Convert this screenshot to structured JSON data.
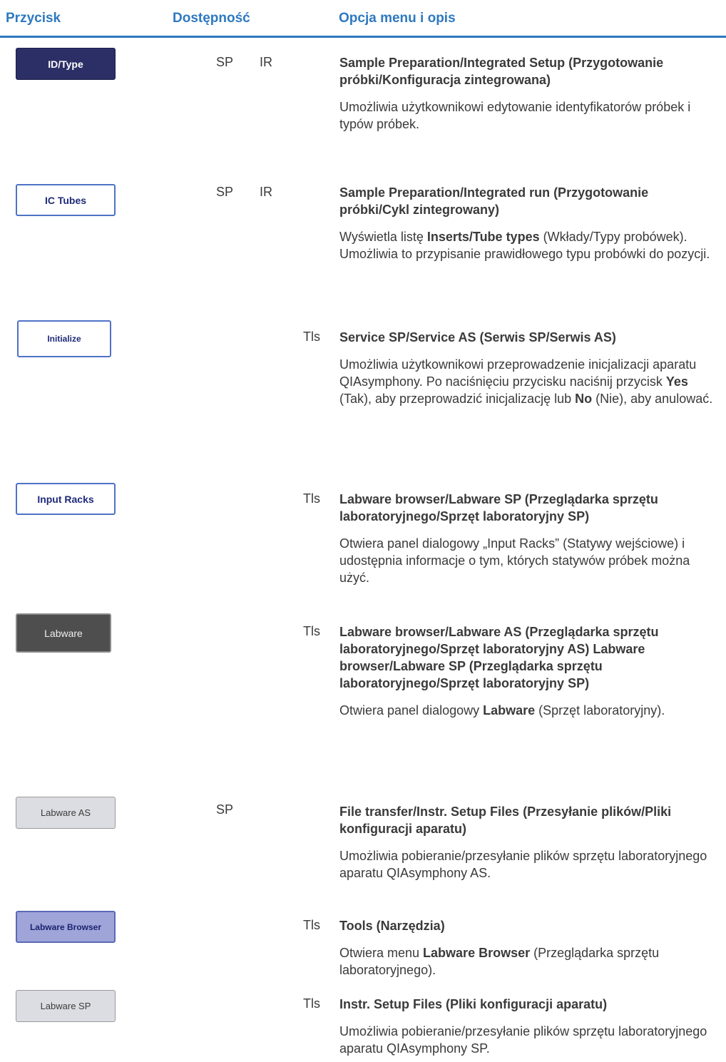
{
  "header": {
    "col1": "Przycisk",
    "col2": "Dostępność",
    "col3": "Opcja menu i opis"
  },
  "rows": [
    {
      "button": "ID/Type",
      "avail": [
        "SP",
        "IR"
      ],
      "title": "Sample Preparation/Integrated Setup (Przygotowanie próbki/Konfiguracja zintegrowana)",
      "desc": "Umożliwia użytkownikowi edytowanie identyfikatorów próbek i typów próbek."
    },
    {
      "button": "IC Tubes",
      "avail": [
        "SP",
        "IR"
      ],
      "title": "Sample Preparation/Integrated run (Przygotowanie próbki/Cykl zintegrowany)",
      "desc_a": "Wyświetla listę ",
      "desc_b": "Inserts/Tube types",
      "desc_c": " (Wkłady/Typy probówek). Umożliwia to przypisanie prawidłowego typu probówki do pozycji."
    },
    {
      "button": "Initialize",
      "avail": [
        "Tls"
      ],
      "title": "Service SP/Service AS (Serwis SP/Serwis AS)",
      "desc_a": "Umożliwia użytkownikowi przeprowadzenie inicjalizacji aparatu QIAsymphony. Po naciśnięciu przycisku naciśnij przycisk ",
      "desc_b": "Yes",
      "desc_c": " (Tak), aby przeprowadzić inicjalizację lub ",
      "desc_d": "No",
      "desc_e": " (Nie), aby anulować."
    },
    {
      "button": "Input Racks",
      "avail": [
        "Tls"
      ],
      "title": "Labware browser/Labware SP (Przeglądarka sprzętu laboratoryjnego/Sprzęt laboratoryjny SP)",
      "desc": "Otwiera panel dialogowy „Input Racks” (Statywy wejściowe) i udostępnia informacje o tym, których statywów próbek można użyć."
    },
    {
      "button": "Labware",
      "avail": [
        "Tls"
      ],
      "title": "Labware browser/Labware AS (Przeglądarka sprzętu laboratoryjnego/Sprzęt laboratoryjny AS) Labware browser/Labware SP (Przeglądarka sprzętu laboratoryjnego/Sprzęt laboratoryjny SP)",
      "desc_a": "Otwiera panel dialogowy ",
      "desc_b": "Labware",
      "desc_c": " (Sprzęt laboratoryjny)."
    },
    {
      "button": "Labware AS",
      "avail": [
        "SP"
      ],
      "title": "File transfer/Instr. Setup Files (Przesyłanie plików/Pliki konfiguracji aparatu)",
      "desc": "Umożliwia pobieranie/przesyłanie plików sprzętu laboratoryjnego aparatu QIAsymphony AS."
    },
    {
      "button": "Labware Browser",
      "avail": [
        "Tls"
      ],
      "title": "Tools (Narzędzia)",
      "desc_a": "Otwiera menu ",
      "desc_b": "Labware Browser",
      "desc_c": " (Przeglądarka sprzętu laboratoryjnego)."
    },
    {
      "button": "Labware SP",
      "avail": [
        "Tls"
      ],
      "title": "Instr. Setup Files (Pliki konfiguracji aparatu)",
      "desc": "Umożliwia pobieranie/przesyłanie plików sprzętu laboratoryjnego aparatu QIAsymphony SP."
    }
  ]
}
